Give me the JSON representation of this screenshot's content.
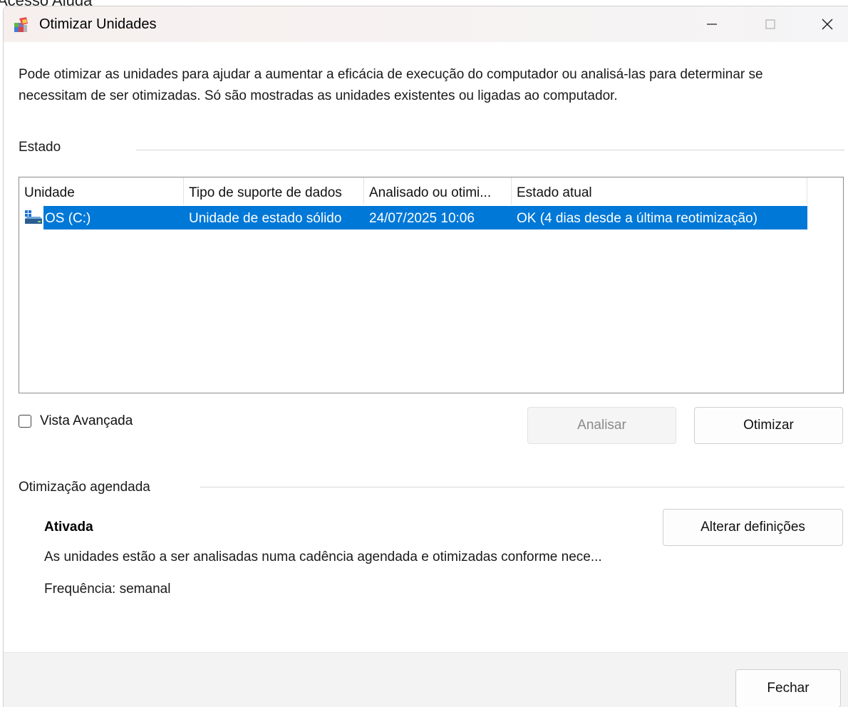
{
  "backdrop": {
    "text": "Acesso    Ajuda"
  },
  "window": {
    "title": "Otimizar Unidades",
    "controls": {
      "minimize": "minimize",
      "maximize": "maximize",
      "close": "close"
    }
  },
  "intro": "Pode otimizar as unidades para ajudar a aumentar a eficácia de execução do computador ou analisá-las para determinar se necessitam de ser otimizadas. Só são mostradas as unidades existentes ou ligadas ao computador.",
  "status_section": {
    "label": "Estado",
    "columns": [
      "Unidade",
      "Tipo de suporte de dados",
      "Analisado ou otimi...",
      "Estado atual"
    ],
    "rows": [
      {
        "drive": "OS (C:)",
        "media_type": "Unidade de estado sólido",
        "last_run": "24/07/2025 10:06",
        "current_status": "OK (4 dias desde a última reotimização)",
        "selected": true
      }
    ]
  },
  "advanced_view": {
    "label": "Vista Avançada",
    "checked": false
  },
  "buttons": {
    "analyze": "Analisar",
    "optimize": "Otimizar",
    "change_settings": "Alterar definições",
    "close": "Fechar"
  },
  "scheduled": {
    "label": "Otimização agendada",
    "state": "Ativada",
    "description": "As unidades estão a ser analisadas numa cadência agendada e otimizadas conforme nece...",
    "frequency": "Frequência: semanal"
  },
  "colors": {
    "selection": "#0078d7",
    "footer_bg": "#f3f3f3"
  }
}
